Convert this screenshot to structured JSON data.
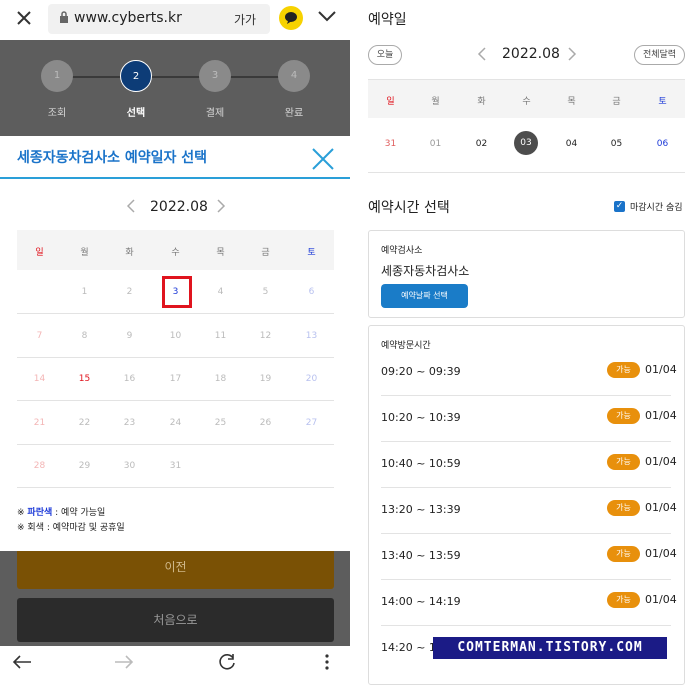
{
  "browser": {
    "url": "www.cyberts.kr",
    "font_size_label": "가가"
  },
  "steps": [
    {
      "num": "1",
      "label": "조회"
    },
    {
      "num": "2",
      "label": "선택"
    },
    {
      "num": "3",
      "label": "결제"
    },
    {
      "num": "4",
      "label": "완료"
    }
  ],
  "modal": {
    "title": "세종자동차검사소 예약일자 선택",
    "month": "2022.08",
    "weekdays": [
      "일",
      "월",
      "화",
      "수",
      "목",
      "금",
      "토"
    ],
    "weeks": [
      [
        "",
        "1",
        "2",
        "3",
        "4",
        "5",
        "6"
      ],
      [
        "7",
        "8",
        "9",
        "10",
        "11",
        "12",
        "13"
      ],
      [
        "14",
        "15",
        "16",
        "17",
        "18",
        "19",
        "20"
      ],
      [
        "21",
        "22",
        "23",
        "24",
        "25",
        "26",
        "27"
      ],
      [
        "28",
        "29",
        "30",
        "31",
        "",
        "",
        ""
      ]
    ],
    "legend_blue_mark": "※",
    "legend_blue_label": "파란색",
    "legend_blue_text": ": 예약 가능일",
    "legend_gray_mark": "※",
    "legend_gray_label": "회색",
    "legend_gray_text": ": 예약마감 및 공휴일"
  },
  "buttons": {
    "prev": "이전",
    "first": "처음으로"
  },
  "right": {
    "title": "예약일",
    "today": "오늘",
    "month": "2022.08",
    "full_calendar": "전체달력",
    "weekdays": [
      "일",
      "월",
      "화",
      "수",
      "목",
      "금",
      "토"
    ],
    "days": [
      "31",
      "01",
      "02",
      "03",
      "04",
      "05",
      "06"
    ],
    "section_title": "예약시간 선택",
    "hide_closed_label": "마감시간 숨김",
    "station_label": "예약검사소",
    "station_name": "세종자동차검사소",
    "select_date_button": "예약날짜 선택",
    "visit_time_label": "예약방문시간",
    "slots": [
      {
        "time": "09:20 ~ 09:39",
        "status": "가능",
        "count": "01/04"
      },
      {
        "time": "10:20 ~ 10:39",
        "status": "가능",
        "count": "01/04"
      },
      {
        "time": "10:40 ~ 10:59",
        "status": "가능",
        "count": "01/04"
      },
      {
        "time": "13:20 ~ 13:39",
        "status": "가능",
        "count": "01/04"
      },
      {
        "time": "13:40 ~ 13:59",
        "status": "가능",
        "count": "01/04"
      },
      {
        "time": "14:00 ~ 14:19",
        "status": "가능",
        "count": "01/04"
      },
      {
        "time": "14:20 ~ 14",
        "status": "",
        "count": ""
      }
    ]
  },
  "watermark": "COMTERMAN.TISTORY.COM",
  "colors": {
    "accent_blue": "#1a73c9",
    "status_orange": "#e8900c",
    "highlight_red": "#e0141e",
    "sunday_red": "#e0141e",
    "saturday_blue": "#1d3ad8"
  }
}
